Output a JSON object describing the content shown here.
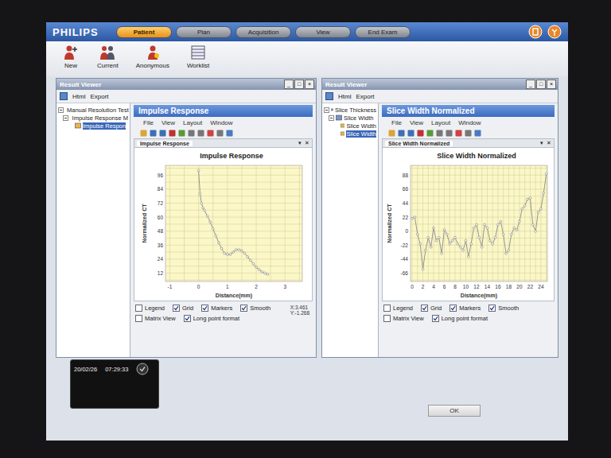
{
  "app": {
    "logo": "PHILIPS",
    "tabs": [
      {
        "label": "Patient",
        "selected": true
      },
      {
        "label": "Plan",
        "selected": false
      },
      {
        "label": "Acquisition",
        "selected": false
      },
      {
        "label": "View",
        "selected": false
      },
      {
        "label": "End Exam",
        "selected": false
      }
    ]
  },
  "toolbar": [
    {
      "label": "New"
    },
    {
      "label": "Current"
    },
    {
      "label": "Anonymous"
    },
    {
      "label": "Worklist"
    }
  ],
  "windows": [
    {
      "title": "Result Viewer",
      "controls": [
        "_",
        "□",
        "×"
      ],
      "menu": [
        "Html",
        "Export"
      ],
      "tree": [
        {
          "label": "Manual Resolution Test",
          "depth": 0,
          "selected": false
        },
        {
          "label": "Impulse Response M",
          "depth": 1,
          "selected": false
        },
        {
          "label": "Impulse Respon",
          "depth": 2,
          "selected": true
        }
      ],
      "panel": {
        "title": "Impulse Response",
        "menu": [
          "File",
          "View",
          "Layout",
          "Window"
        ],
        "tab": "Impulse Response",
        "tab_controls": [
          "▾",
          "✕"
        ],
        "chart": {
          "title": "Impulse Response",
          "y_label": "Normalized CT",
          "x_label": "Distance(mm)",
          "y_ticks": [
            "96",
            "84",
            "72",
            "60",
            "48",
            "36",
            "24",
            "12"
          ],
          "x_ticks": [
            "-1",
            "0",
            "1",
            "2",
            "3"
          ],
          "series": [
            {
              "x": [
                0,
                0.05,
                0.1,
                0.15,
                0.2,
                0.3,
                0.4,
                0.5,
                0.6,
                0.7,
                0.8,
                0.9,
                1.0,
                1.1,
                1.2,
                1.3,
                1.4,
                1.5,
                1.6,
                1.7,
                1.8,
                1.9,
                2.0,
                2.1,
                2.2,
                2.3,
                2.4
              ],
              "y": [
                100,
                80,
                72,
                68,
                66,
                61,
                56,
                50,
                44,
                38,
                33,
                29,
                28,
                28,
                30,
                32,
                32,
                31,
                29,
                26,
                23,
                20,
                17,
                15,
                13,
                12,
                11
              ]
            }
          ]
        },
        "option_rows": [
          [
            {
              "label": "Legend",
              "checked": false
            },
            {
              "label": "Grid",
              "checked": true
            },
            {
              "label": "Markers",
              "checked": true
            },
            {
              "label": "Smooth",
              "checked": true
            }
          ],
          [
            {
              "label": "Matrix View",
              "checked": false
            },
            {
              "label": "Long point format",
              "checked": true
            }
          ]
        ],
        "readout": [
          "X:3.461",
          "Y:-1.268"
        ]
      }
    },
    {
      "title": "Result Viewer",
      "controls": [
        "_",
        "□",
        "×"
      ],
      "menu": [
        "Html",
        "Export"
      ],
      "tree": [
        {
          "label": "Slice Thickness",
          "depth": 0,
          "selected": false
        },
        {
          "label": "Slice Width",
          "depth": 1,
          "selected": false
        },
        {
          "label": "Slice Width",
          "depth": 2,
          "selected": false
        },
        {
          "label": "Slice Width",
          "depth": 2,
          "selected": true
        }
      ],
      "panel": {
        "title": "Slice Width Normalized",
        "menu": [
          "File",
          "View",
          "Layout",
          "Window"
        ],
        "tab": "Slice Width Normalized",
        "tab_controls": [
          "▾",
          "✕"
        ],
        "chart": {
          "title": "Slice Width Normalized",
          "y_label": "Normalized CT",
          "x_label": "Distance(mm)",
          "y_ticks": [
            "88",
            "66",
            "44",
            "22",
            "0",
            "-22",
            "-44",
            "-66"
          ],
          "x_ticks": [
            "0",
            "2",
            "4",
            "6",
            "8",
            "10",
            "12",
            "14",
            "16",
            "18",
            "20",
            "22",
            "24"
          ],
          "series": [
            {
              "x": [
                0,
                0.5,
                1,
                1.5,
                2,
                2.5,
                3,
                3.5,
                4,
                4.5,
                5,
                5.5,
                6,
                6.5,
                7,
                7.5,
                8,
                8.5,
                9,
                9.5,
                10,
                10.5,
                11,
                11.5,
                12,
                12.5,
                13,
                13.5,
                14,
                14.5,
                15,
                15.5,
                16,
                16.5,
                17,
                17.5,
                18,
                18.5,
                19,
                19.5,
                20,
                20.5,
                21,
                21.5,
                22,
                22.5,
                23,
                23.5,
                24,
                24.5,
                25
              ],
              "y": [
                20,
                22,
                -5,
                -20,
                -60,
                -30,
                -10,
                -25,
                5,
                -15,
                -10,
                -35,
                2,
                -5,
                -20,
                -15,
                -10,
                -20,
                -25,
                -30,
                -15,
                -40,
                -20,
                5,
                10,
                -10,
                -25,
                10,
                5,
                -15,
                -20,
                -10,
                10,
                15,
                -5,
                -35,
                -30,
                -5,
                5,
                2,
                15,
                35,
                40,
                50,
                52,
                10,
                0,
                30,
                35,
                60,
                90
              ]
            }
          ]
        },
        "option_rows": [
          [
            {
              "label": "Legend",
              "checked": false
            },
            {
              "label": "Grid",
              "checked": true
            },
            {
              "label": "Markers",
              "checked": true
            },
            {
              "label": "Smooth",
              "checked": true
            }
          ],
          [
            {
              "label": "Matrix View",
              "checked": false
            },
            {
              "label": "Long point format",
              "checked": true
            }
          ]
        ],
        "readout": []
      }
    }
  ],
  "session": {
    "date": "20/02/26",
    "time": "07:29:33"
  },
  "buttons": [
    "OK"
  ]
}
